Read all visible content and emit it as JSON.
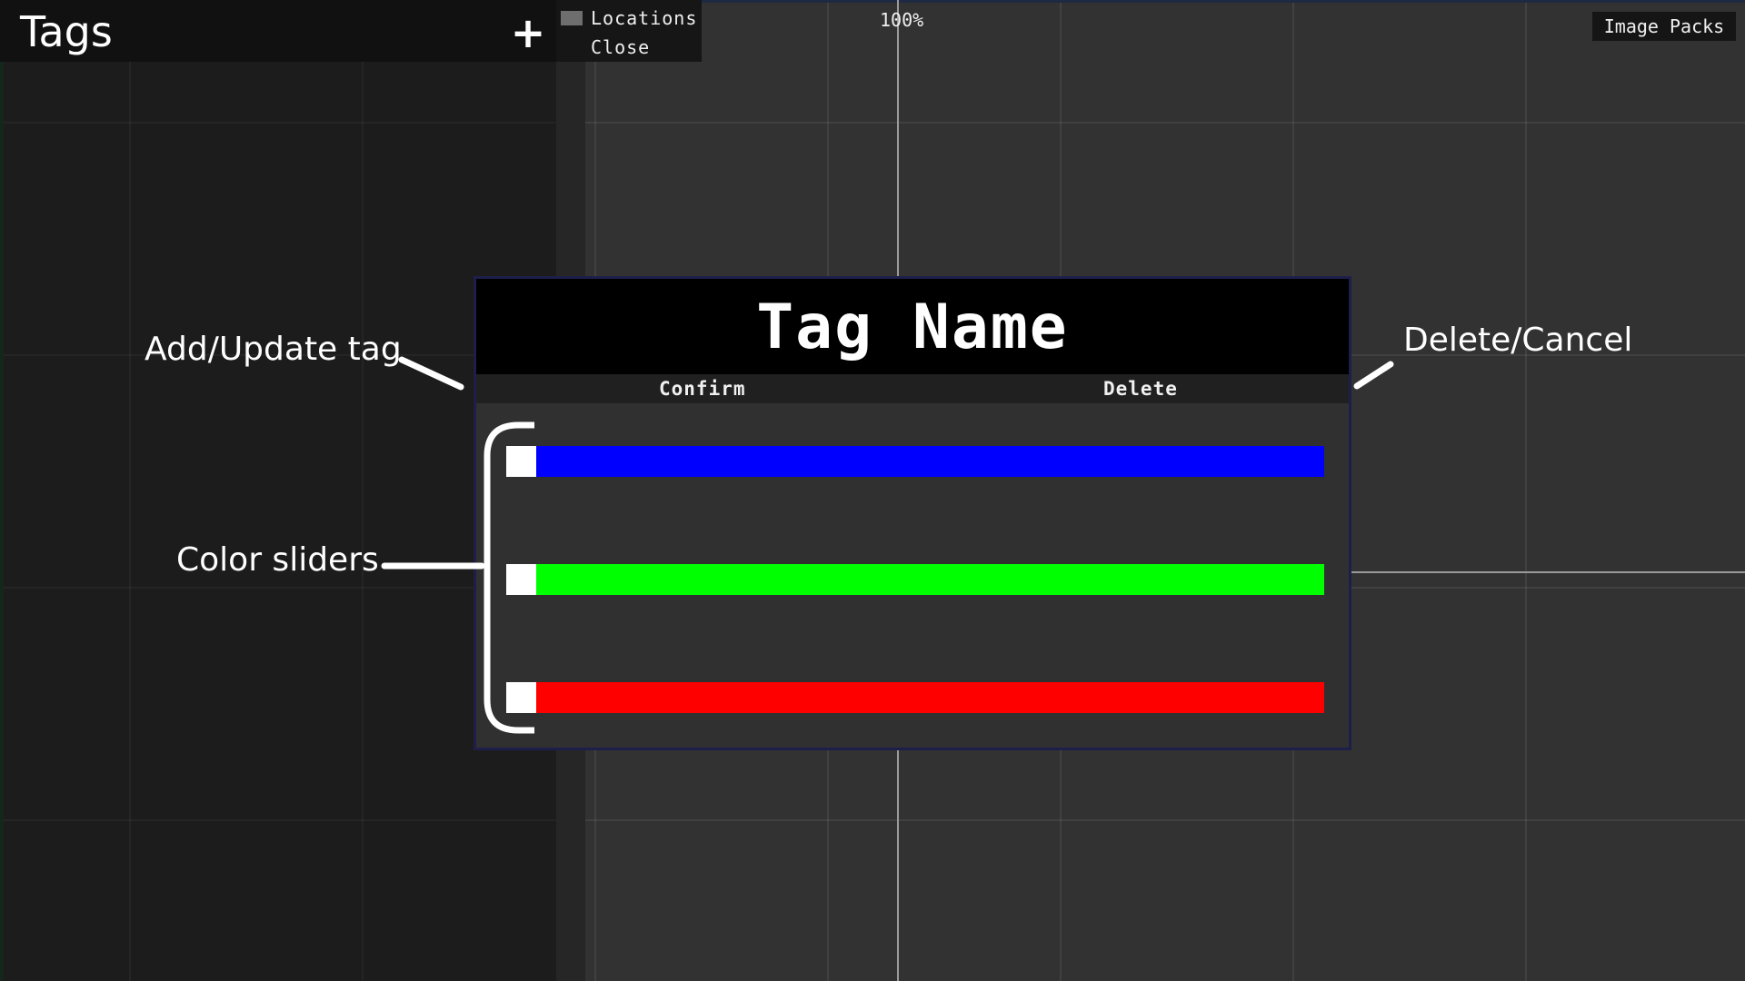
{
  "tags_panel": {
    "title": "Tags",
    "add_label": "+"
  },
  "locations_menu": {
    "items": [
      "Locations",
      "Close"
    ]
  },
  "zoom": "100%",
  "image_packs_label": "Image Packs",
  "dialog": {
    "title": "Tag Name",
    "confirm_label": "Confirm",
    "delete_label": "Delete",
    "sliders": [
      {
        "channel": "blue",
        "color": "#0000ff"
      },
      {
        "channel": "green",
        "color": "#00ff00"
      },
      {
        "channel": "red",
        "color": "#ff0000"
      }
    ]
  },
  "annotations": {
    "add_update": "Add/Update tag",
    "delete_cancel": "Delete/Cancel",
    "color_sliders": "Color sliders"
  }
}
